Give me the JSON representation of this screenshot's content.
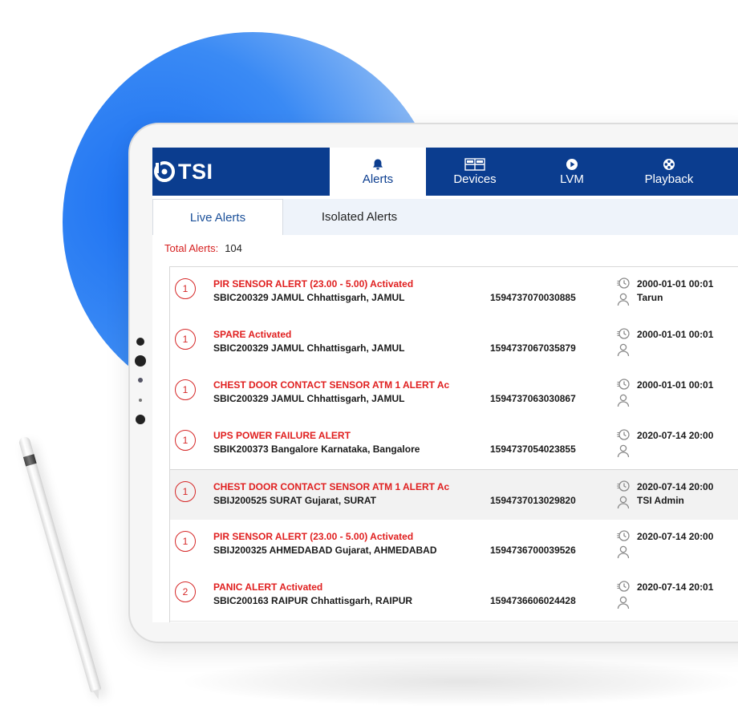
{
  "app": {
    "logo_text": "TSI"
  },
  "nav": {
    "tabs": [
      {
        "label": "Alerts",
        "icon": "bell-icon",
        "active": true
      },
      {
        "label": "Devices",
        "icon": "grid-icon",
        "active": false
      },
      {
        "label": "LVM",
        "icon": "play-circle-icon",
        "active": false
      },
      {
        "label": "Playback",
        "icon": "film-reel-icon",
        "active": false
      }
    ]
  },
  "subtabs": [
    {
      "label": "Live Alerts",
      "active": true
    },
    {
      "label": "Isolated Alerts",
      "active": false
    }
  ],
  "summary": {
    "label": "Total Alerts:",
    "value": "104"
  },
  "alerts": [
    {
      "count": "1",
      "title": "PIR SENSOR ALERT (23.00 - 5.00) Activated",
      "site": "SBIC200329 JAMUL Chhattisgarh, JAMUL",
      "id": "1594737070030885",
      "time": "2000-01-01 00:01",
      "user": "Tarun"
    },
    {
      "count": "1",
      "title": "SPARE Activated",
      "site": "SBIC200329 JAMUL Chhattisgarh, JAMUL",
      "id": "1594737067035879",
      "time": "2000-01-01 00:01",
      "user": ""
    },
    {
      "count": "1",
      "title": "CHEST DOOR CONTACT SENSOR ATM 1 ALERT Ac",
      "site": "SBIC200329 JAMUL Chhattisgarh, JAMUL",
      "id": "1594737063030867",
      "time": "2000-01-01 00:01",
      "user": ""
    },
    {
      "count": "1",
      "title": "UPS POWER FAILURE ALERT",
      "site": "SBIK200373 Bangalore Karnataka, Bangalore",
      "id": "1594737054023855",
      "time": "2020-07-14 20:00",
      "user": ""
    },
    {
      "count": "1",
      "title": "CHEST DOOR CONTACT SENSOR ATM 1 ALERT Ac",
      "site": "SBIJ200525 SURAT Gujarat, SURAT",
      "id": "1594737013029820",
      "time": "2020-07-14 20:00",
      "user": "TSI Admin"
    },
    {
      "count": "1",
      "title": "PIR SENSOR ALERT (23.00 - 5.00) Activated",
      "site": "SBIJ200325 AHMEDABAD Gujarat, AHMEDABAD",
      "id": "1594736700039526",
      "time": "2020-07-14 20:00",
      "user": ""
    },
    {
      "count": "2",
      "title": "PANIC ALERT Activated",
      "site": "SBIC200163 RAIPUR Chhattisgarh, RAIPUR",
      "id": "1594736606024428",
      "time": "2020-07-14 20:01",
      "user": ""
    }
  ],
  "selected_row": 4,
  "colors": {
    "nav_bg": "#0b3d8f",
    "alert_red": "#e02020",
    "accent_circle": "#1a6ff2"
  }
}
